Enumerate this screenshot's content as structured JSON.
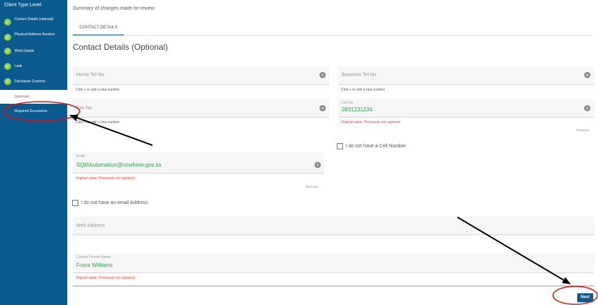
{
  "sidebar": {
    "title": "Client Type Level",
    "items": [
      {
        "label": "Contact Details (optional)"
      },
      {
        "label": "Physical Address /location"
      },
      {
        "label": "Work Details"
      },
      {
        "label": "Limit"
      },
      {
        "label": "Disclosure Customs"
      }
    ],
    "summary_label": "Summary",
    "required_documents_label": "Required Documents"
  },
  "page": {
    "subtitle": "Summary of changes made for review",
    "tab_label": "CONTACT DETAILS",
    "heading": "Contact Details (Optional)"
  },
  "form": {
    "home_tel": {
      "placeholder": "Home Tel No",
      "hint": "Click + to add a new number"
    },
    "business_tel": {
      "placeholder": "Business Tel No",
      "hint": "Click + to add a new number"
    },
    "fax": {
      "placeholder": "Fax No",
      "hint": "Click + to add a new number"
    },
    "cell": {
      "label": "Cell No",
      "value": "0831231234",
      "original": "Original value: Previously not captured",
      "remove": "Remove"
    },
    "no_cell_checkbox": "I do not have a Cell Number",
    "email": {
      "label": "Email",
      "value": "SQMAutomation@nowhere.gov.za",
      "original": "Original value: Previously not captured",
      "remove": "Remove"
    },
    "no_email_checkbox": "I do not have an email Address",
    "web_address": {
      "placeholder": "Web Address"
    },
    "contact_person": {
      "label": "Contact Person Name",
      "value": "Frans Williams",
      "original": "Original value: Previously not captured"
    }
  },
  "buttons": {
    "next": "Next"
  },
  "colors": {
    "sidebar": "#0a5a8f",
    "check": "#8fd14f",
    "value_green": "#2aa34a",
    "error_red": "#e03b3b",
    "annotation_red": "#e01010"
  }
}
